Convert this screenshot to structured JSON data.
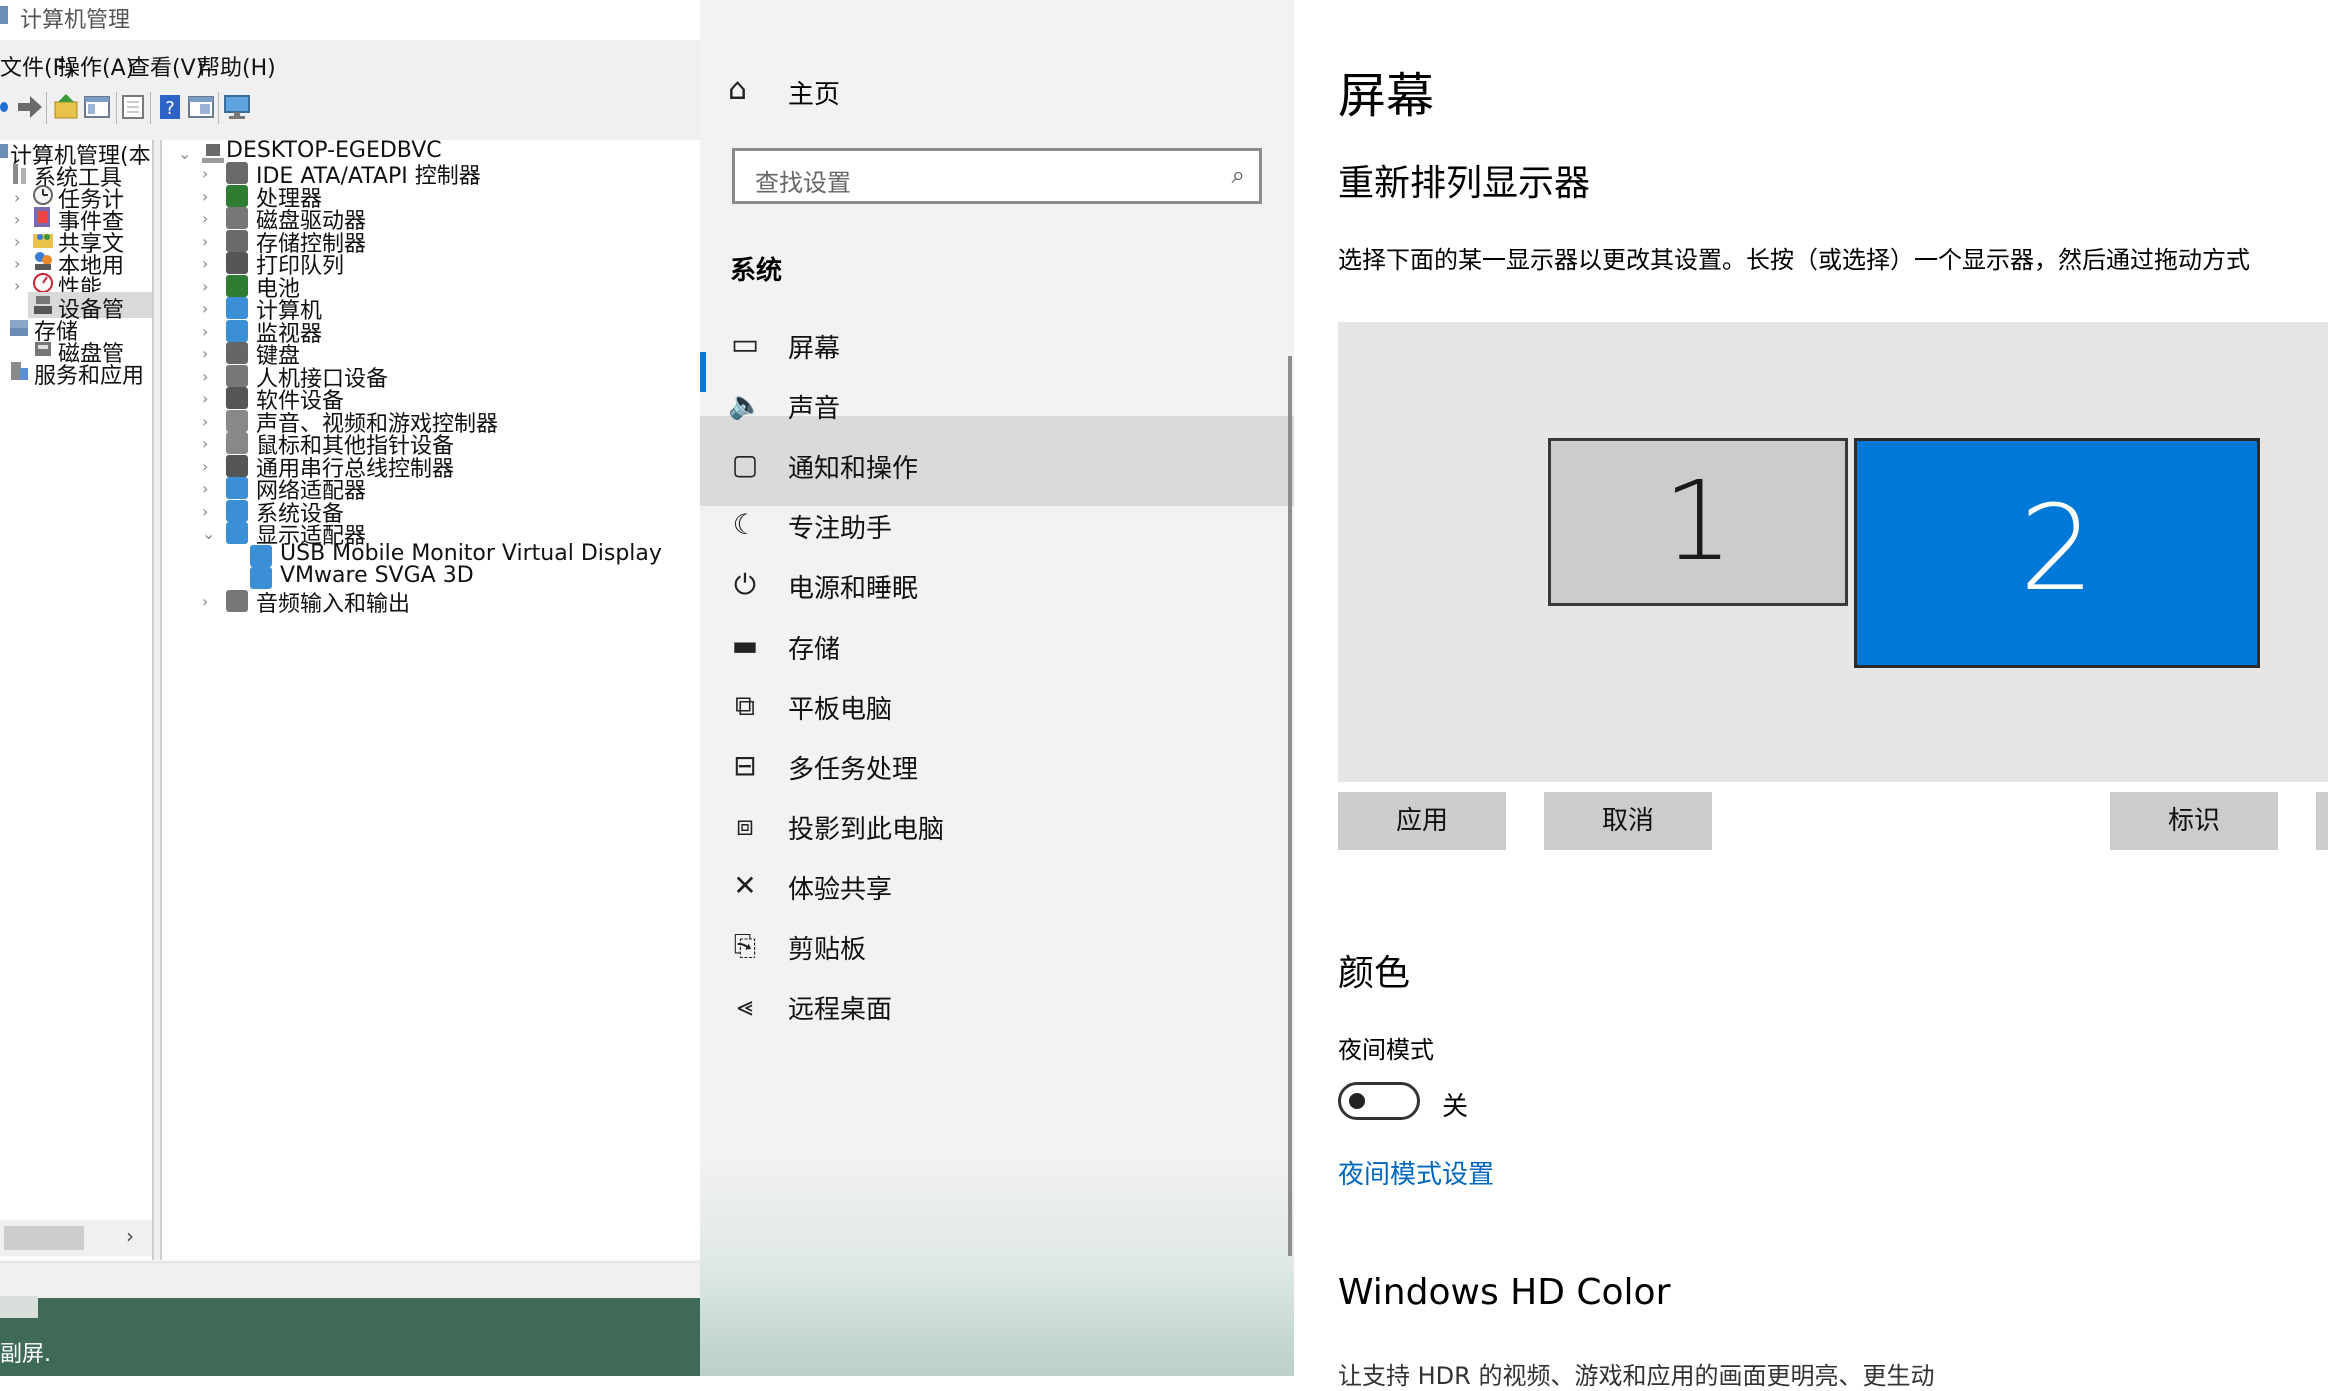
{
  "computer_management": {
    "title": "计算机管理",
    "menu": [
      "文件(F)",
      "操作(A)",
      "查看(V)",
      "帮助(H)"
    ],
    "left_tree": {
      "root": "计算机管理(本",
      "system_tools": "系统工具",
      "items": [
        "任务计",
        "事件查",
        "共享文",
        "本地用",
        "性能",
        "设备管"
      ],
      "storage": "存储",
      "disk_mgmt": "磁盘管",
      "services": "服务和应用"
    },
    "device_tree": {
      "computer": "DESKTOP-EGEDBVC",
      "categories": [
        "IDE ATA/ATAPI 控制器",
        "处理器",
        "磁盘驱动器",
        "存储控制器",
        "打印队列",
        "电池",
        "计算机",
        "监视器",
        "键盘",
        "人机接口设备",
        "软件设备",
        "声音、视频和游戏控制器",
        "鼠标和其他指针设备",
        "通用串行总线控制器",
        "网络适配器",
        "系统设备",
        "显示适配器"
      ],
      "display_adapters": [
        "USB Mobile Monitor Virtual Display",
        "VMware SVGA 3D"
      ],
      "last_category": "音频输入和输出"
    },
    "scroll_arrow": "›",
    "desktop_label": "副屏."
  },
  "settings_nav": {
    "home": "主页",
    "search_placeholder": "查找设置",
    "section": "系统",
    "items": [
      "屏幕",
      "声音",
      "通知和操作",
      "专注助手",
      "电源和睡眠",
      "存储",
      "平板电脑",
      "多任务处理",
      "投影到此电脑",
      "体验共享",
      "剪贴板",
      "远程桌面"
    ],
    "icons": [
      "monitor-icon",
      "speaker-icon",
      "notification-icon",
      "moon-icon",
      "power-icon",
      "storage-icon",
      "tablet-icon",
      "multitask-icon",
      "project-icon",
      "share-icon",
      "clipboard-icon",
      "remote-icon"
    ]
  },
  "content": {
    "title": "屏幕",
    "arrange_heading": "重新排列显示器",
    "arrange_desc": "选择下面的某一显示器以更改其设置。长按（或选择）一个显示器，然后通过拖动方式",
    "monitor1": "1",
    "monitor2": "2",
    "apply_label": "应用",
    "cancel_label": "取消",
    "identify_label": "标识",
    "color_heading": "颜色",
    "night_mode_label": "夜间模式",
    "night_mode_state": "关",
    "night_mode_link": "夜间模式设置",
    "hd_heading": "Windows HD Color",
    "hd_desc": "让支持 HDR 的视频、游戏和应用的画面更明亮、更生动"
  },
  "colors": {
    "accent": "#0078d7",
    "link": "#0067c0",
    "selected_monitor": "#0078d7"
  }
}
